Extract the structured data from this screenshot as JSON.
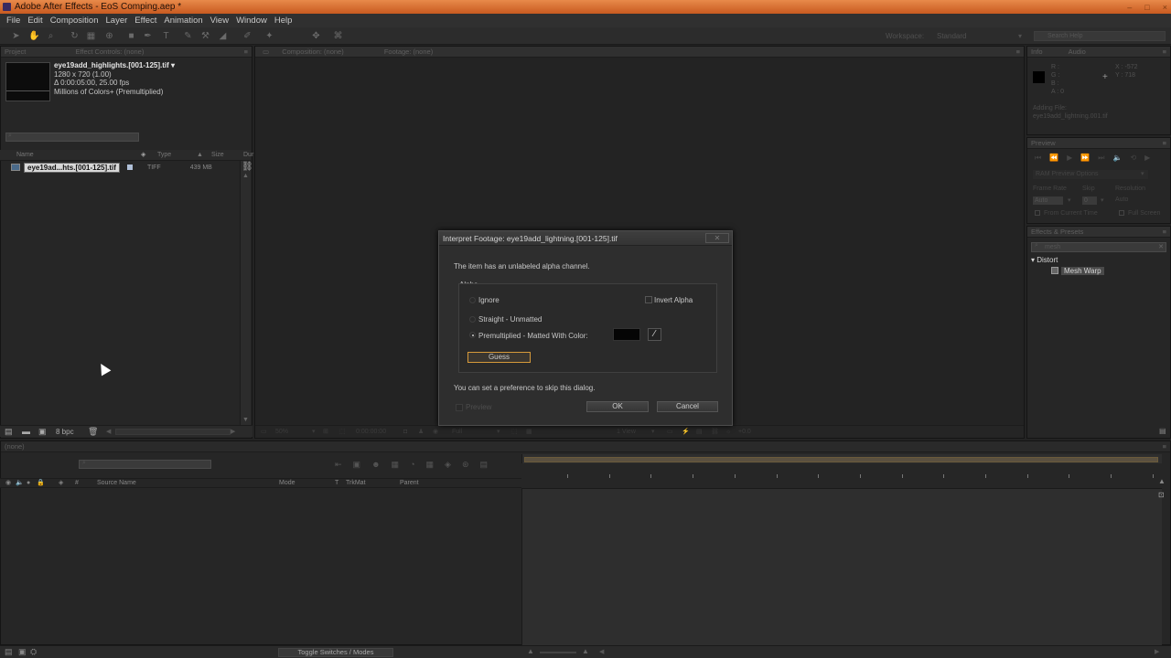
{
  "window": {
    "title": "Adobe After Effects - EoS Comping.aep *",
    "controls": [
      "–",
      "□",
      "×"
    ]
  },
  "menu": [
    "File",
    "Edit",
    "Composition",
    "Layer",
    "Effect",
    "Animation",
    "View",
    "Window",
    "Help"
  ],
  "toolbar": {
    "workspace_label": "Workspace:",
    "workspace_value": "Standard",
    "search_placeholder": "Search Help"
  },
  "project_panel": {
    "tabs": [
      "Project",
      "Effect Controls: (none)"
    ],
    "file_name": "eye19add_highlights.[001-125].tif ▾",
    "dimensions": "1280 x 720 (1.00)",
    "duration": "Δ 0:00:05:00, 25.00 fps",
    "colors": "Millions of Colors+ (Premultiplied)",
    "columns": [
      "Name",
      "Type",
      "Size",
      "Dur"
    ],
    "items": [
      {
        "name": "eye19ad...hts.[001-125].tif",
        "type": "TIFF",
        "size": "439 MB"
      }
    ],
    "bpc": "8 bpc"
  },
  "comp_panel": {
    "tabs": [
      "Composition: (none)",
      "Footage: (none)"
    ],
    "zoom": "50%",
    "timecode": "0:00:00:00",
    "view": "Full",
    "views": "1 View",
    "offset": "+0.0"
  },
  "info_panel": {
    "tabs": [
      "Info",
      "Audio"
    ],
    "r": "R :",
    "g": "G :",
    "b": "B :",
    "a": "A : 0",
    "x": "X : -572",
    "y": "Y : 718",
    "status_title": "Adding File:",
    "status_file": "eye19add_lightning.001.tif"
  },
  "preview_panel": {
    "tab": "Preview",
    "ram_options": "RAM Preview Options",
    "frame_rate_label": "Frame Rate",
    "skip_label": "Skip",
    "resolution_label": "Resolution",
    "frame_rate": "Auto",
    "skip": "0",
    "resolution": "Auto",
    "from_current": "From Current Time",
    "full_screen": "Full Screen"
  },
  "effects_panel": {
    "tab": "Effects & Presets",
    "search": "mesh",
    "category": "Distort",
    "effect": "Mesh Warp"
  },
  "timeline_panel": {
    "tab": "(none)",
    "columns": [
      "Source Name",
      "Mode",
      "T",
      "TrkMat",
      "Parent"
    ],
    "toggle_label": "Toggle Switches / Modes"
  },
  "dialog": {
    "title": "Interpret Footage: eye19add_lightning.[001-125].tif",
    "message": "The item has an unlabeled alpha channel.",
    "group_label": "Alpha",
    "ignore": "Ignore",
    "invert_alpha": "Invert Alpha",
    "straight": "Straight - Unmatted",
    "premultiplied": "Premultiplied - Matted With Color:",
    "guess": "Guess",
    "pref_note": "You can set a preference to skip this dialog.",
    "preview": "Preview",
    "ok": "OK",
    "cancel": "Cancel",
    "matte_color": "#050505",
    "selected_option": "premultiplied"
  },
  "colors": {
    "title_bar": "#d87038",
    "panel_bg": "#262626",
    "guess_border": "#d69a3a"
  }
}
